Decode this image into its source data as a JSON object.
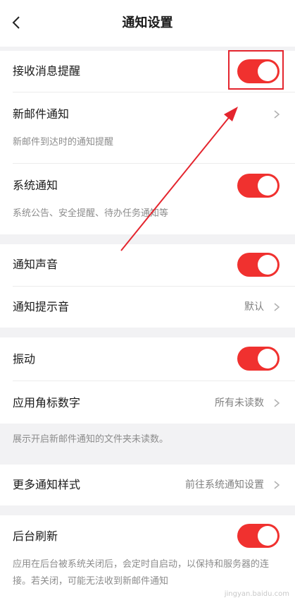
{
  "header": {
    "title": "通知设置",
    "back_icon": "chevron-left-icon"
  },
  "rows": {
    "receive": {
      "label": "接收消息提醒",
      "toggle_on": true
    },
    "new_mail": {
      "label": "新邮件通知",
      "sub": "新邮件到达时的通知提醒"
    },
    "system": {
      "label": "系统通知",
      "sub": "系统公告、安全提醒、待办任务通知等",
      "toggle_on": true
    },
    "sound": {
      "label": "通知声音",
      "toggle_on": true
    },
    "ringtone": {
      "label": "通知提示音",
      "value": "默认"
    },
    "vibrate": {
      "label": "振动",
      "toggle_on": true
    },
    "badge": {
      "label": "应用角标数字",
      "value": "所有未读数"
    },
    "badge_note": "展示开启新邮件通知的文件夹未读数。",
    "more_styles": {
      "label": "更多通知样式",
      "value": "前往系统通知设置"
    },
    "bg_refresh": {
      "label": "后台刷新",
      "toggle_on": true
    },
    "bg_note": "应用在后台被系统关闭后，会定时自启动，以保持和服务器的连接。若关闭，可能无法收到新邮件通知"
  },
  "colors": {
    "accent": "#f0312f",
    "annotation": "#e4252e"
  },
  "watermark": "jingyan.baidu.com"
}
